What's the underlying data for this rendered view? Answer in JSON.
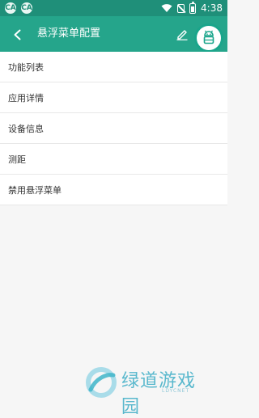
{
  "status_bar": {
    "notif_icons": [
      "CA",
      "CA"
    ],
    "time": "4:38"
  },
  "app_bar": {
    "title": "悬浮菜单配置",
    "back_icon": "arrow-left-icon",
    "edit_icon": "pencil-icon",
    "float_icon": "android-robot-icon"
  },
  "menu": {
    "items": [
      {
        "label": "功能列表"
      },
      {
        "label": "应用详情"
      },
      {
        "label": "设备信息"
      },
      {
        "label": "测距"
      },
      {
        "label": "禁用悬浮菜单"
      }
    ]
  },
  "watermark": {
    "brand": "绿道游戏园",
    "url": "LDYCNET"
  },
  "colors": {
    "primary": "#25a58b",
    "status_bar": "#1f8f79",
    "background": "#f6f6f6"
  }
}
